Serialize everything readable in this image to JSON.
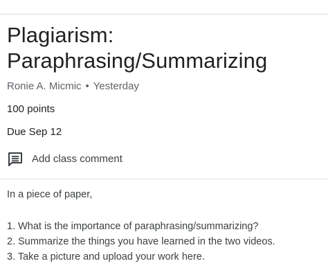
{
  "assignment": {
    "title": "Plagiarism: Paraphrasing/Summarizing",
    "author": "Ronie A. Micmic",
    "separator": "•",
    "posted": "Yesterday",
    "points": "100 points",
    "due": "Due Sep 12"
  },
  "comments": {
    "add_label": "Add class comment",
    "icon": "comment-icon"
  },
  "instructions": {
    "intro": "In a piece of paper,",
    "items": [
      "1. What is the importance of paraphrasing/summarizing?",
      "2. Summarize the things you have learned in the two videos.",
      "3. Take a picture and upload your work here."
    ]
  }
}
